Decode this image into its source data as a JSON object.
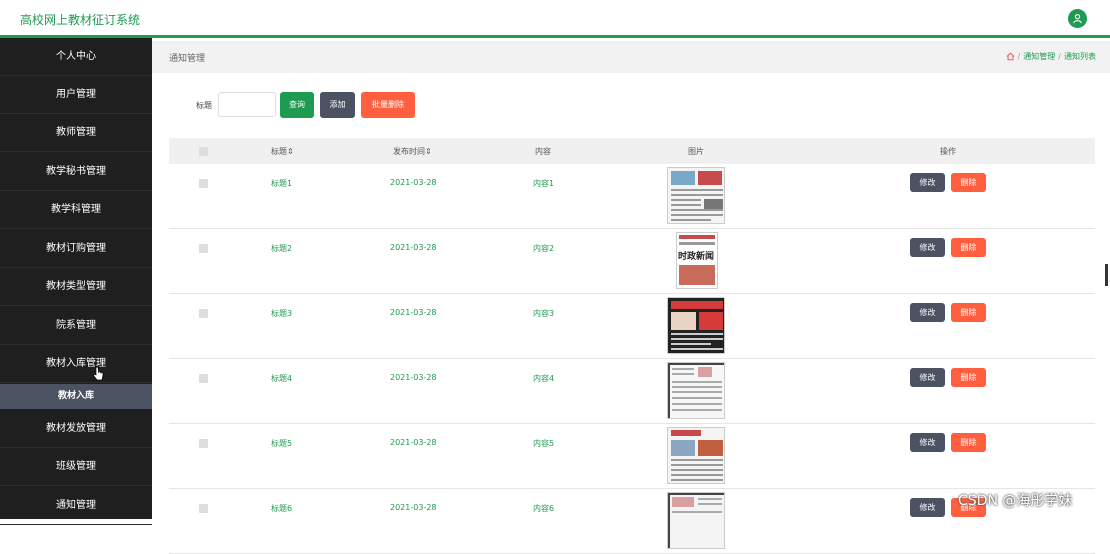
{
  "app": {
    "title": "高校网上教材征订系统"
  },
  "sidebar": {
    "items": [
      {
        "label": "个人中心"
      },
      {
        "label": "用户管理"
      },
      {
        "label": "教师管理"
      },
      {
        "label": "教学秘书管理"
      },
      {
        "label": "教学科管理"
      },
      {
        "label": "教材订购管理"
      },
      {
        "label": "教材类型管理"
      },
      {
        "label": "院系管理"
      },
      {
        "label": "教材入库管理"
      },
      {
        "label": "教材发放管理"
      },
      {
        "label": "班级管理"
      },
      {
        "label": "通知管理"
      }
    ],
    "sub_item": {
      "label": "教材入库"
    }
  },
  "header": {
    "page_title": "通知管理",
    "breadcrumb": [
      "通知管理",
      "通知列表"
    ]
  },
  "search": {
    "label": "标题",
    "value": "",
    "query_button": "查询",
    "add_button": "添加",
    "batch_delete_button": "批量删除"
  },
  "table": {
    "columns": [
      "标题",
      "发布时间",
      "内容",
      "图片",
      "操作"
    ],
    "rows": [
      {
        "title": "标题1",
        "date": "2021-03-28",
        "content": "内容1"
      },
      {
        "title": "标题2",
        "date": "2021-03-28",
        "content": "内容2"
      },
      {
        "title": "标题3",
        "date": "2021-03-28",
        "content": "内容3"
      },
      {
        "title": "标题4",
        "date": "2021-03-28",
        "content": "内容4"
      },
      {
        "title": "标题5",
        "date": "2021-03-28",
        "content": "内容5"
      },
      {
        "title": "标题6",
        "date": "2021-03-28",
        "content": "内容6"
      }
    ],
    "edit_label": "修改",
    "delete_label": "删除"
  },
  "thumb_text": {
    "row2": "时政新闻"
  },
  "watermark": "CSDN @海彤学妹",
  "colors": {
    "accent": "#1f9a51",
    "sidebar": "#1f1f1f",
    "danger": "#ff5f3f",
    "dark_button": "#4b5262"
  },
  "icons": [
    "user-icon",
    "home-icon",
    "cursor-icon",
    "sort-icon"
  ]
}
